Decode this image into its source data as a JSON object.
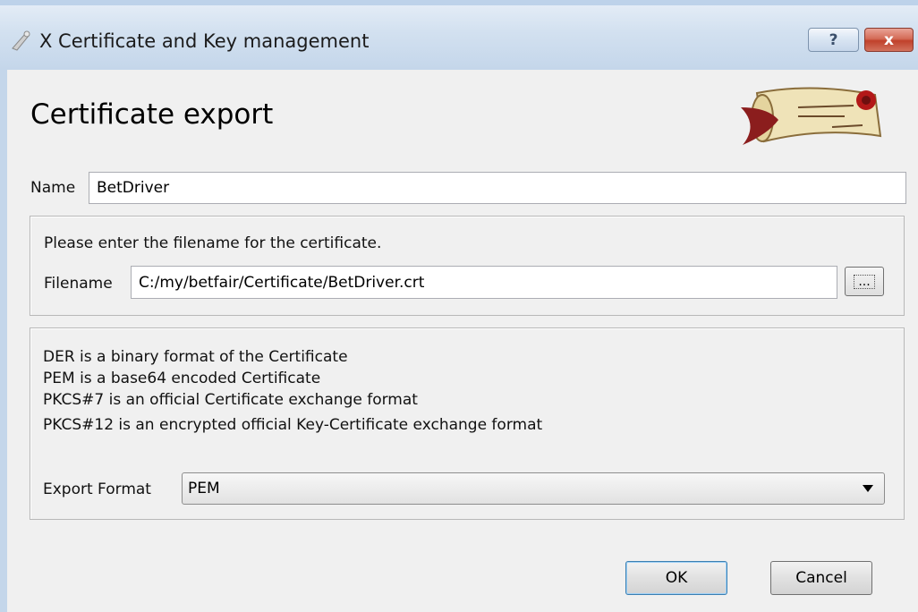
{
  "window": {
    "title": "X Certificate and Key management",
    "help_label": "?",
    "close_label": "x"
  },
  "page": {
    "title": "Certificate export"
  },
  "name_field": {
    "label": "Name",
    "value": "BetDriver"
  },
  "file_group": {
    "prompt": "Please enter the filename for the certificate.",
    "filename_label": "Filename",
    "filename_value": "C:/my/betfair/Certificate/BetDriver.crt",
    "browse_label": "..."
  },
  "format_group": {
    "info_lines": [
      "DER is a binary format of the Certificate",
      "PEM is a base64 encoded Certificate",
      "PKCS#7 is an official Certificate exchange format",
      "PKCS#12 is an encrypted official Key-Certificate exchange format"
    ],
    "format_label": "Export Format",
    "format_value": "PEM"
  },
  "buttons": {
    "ok": "OK",
    "cancel": "Cancel"
  },
  "colors": {
    "titlebar": "#c4d6ea",
    "dialog_bg": "#f0f0f0",
    "close_red": "#c0412b",
    "default_button_border": "#3c7fb1"
  }
}
